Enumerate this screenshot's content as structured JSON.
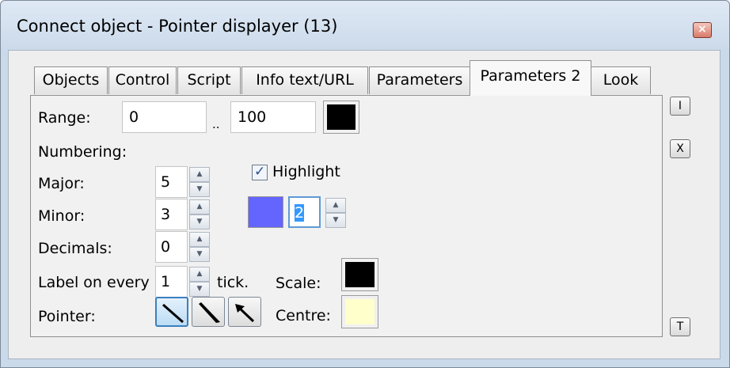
{
  "window": {
    "title": "Connect object - Pointer displayer (13)",
    "close_icon": "close-icon"
  },
  "tabs": [
    {
      "label": "Objects"
    },
    {
      "label": "Control"
    },
    {
      "label": "Script"
    },
    {
      "label": "Info text/URL"
    },
    {
      "label": "Parameters"
    },
    {
      "label": "Parameters 2",
      "active": true
    },
    {
      "label": "Look"
    }
  ],
  "range": {
    "label": "Range:",
    "from": "0",
    "separator": "..",
    "to": "100",
    "color": "#000000"
  },
  "numbering": {
    "label": "Numbering:",
    "major_label": "Major:",
    "major_value": "5",
    "minor_label": "Minor:",
    "minor_value": "3",
    "decimals_label": "Decimals:",
    "decimals_value": "0",
    "label_every_label": "Label on every",
    "label_every_value": "1",
    "tick_label": "tick."
  },
  "highlight": {
    "label": "Highlight",
    "checked": true,
    "color": "#6464ff",
    "value": "2"
  },
  "scale": {
    "label": "Scale:",
    "color": "#000000"
  },
  "centre": {
    "label": "Centre:",
    "color": "#ffffcc"
  },
  "pointer": {
    "label": "Pointer:",
    "styles": [
      "pointer-thin-line-icon",
      "pointer-taper-icon",
      "pointer-arrow-icon"
    ],
    "selected_index": 0
  },
  "side_buttons": [
    {
      "label": "I",
      "icon": "info-icon"
    },
    {
      "label": "X",
      "icon": "x-icon"
    },
    {
      "label": "T",
      "icon": "t-icon"
    }
  ]
}
